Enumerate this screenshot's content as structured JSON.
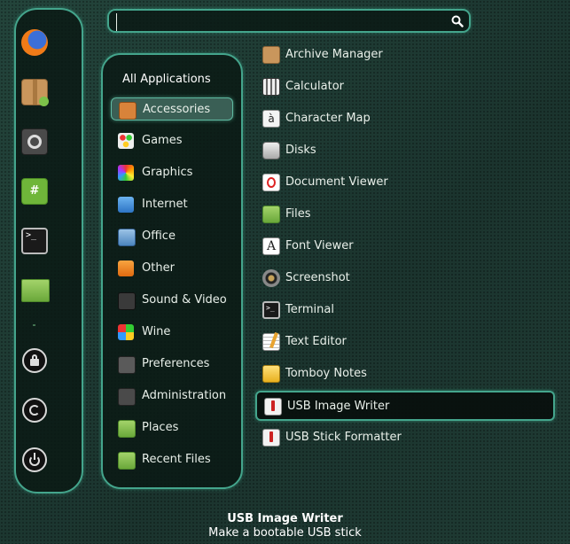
{
  "search": {
    "value": "",
    "placeholder": ""
  },
  "favorites": [
    {
      "name": "firefox-icon"
    },
    {
      "name": "package-installer-icon"
    },
    {
      "name": "system-settings-icon"
    },
    {
      "name": "hexchat-icon"
    },
    {
      "name": "terminal-icon"
    },
    {
      "name": "files-folder-icon"
    },
    {
      "name": "lock-screen-icon"
    },
    {
      "name": "logout-icon"
    },
    {
      "name": "shutdown-icon"
    }
  ],
  "categories": {
    "header": "All Applications",
    "items": [
      {
        "label": "Accessories",
        "selected": true
      },
      {
        "label": "Games"
      },
      {
        "label": "Graphics"
      },
      {
        "label": "Internet"
      },
      {
        "label": "Office"
      },
      {
        "label": "Other"
      },
      {
        "label": "Sound & Video"
      },
      {
        "label": "Wine"
      },
      {
        "label": "Preferences"
      },
      {
        "label": "Administration"
      },
      {
        "label": "Places"
      },
      {
        "label": "Recent Files"
      }
    ]
  },
  "apps": [
    {
      "label": "Archive Manager"
    },
    {
      "label": "Calculator"
    },
    {
      "label": "Character Map",
      "glyph": "à"
    },
    {
      "label": "Disks"
    },
    {
      "label": "Document Viewer"
    },
    {
      "label": "Files"
    },
    {
      "label": "Font Viewer",
      "glyph": "A"
    },
    {
      "label": "Screenshot"
    },
    {
      "label": "Terminal",
      "glyph": ">_"
    },
    {
      "label": "Text Editor"
    },
    {
      "label": "Tomboy Notes"
    },
    {
      "label": "USB Image Writer",
      "selected": true
    },
    {
      "label": "USB Stick Formatter"
    }
  ],
  "status": {
    "title": "USB Image Writer",
    "description": "Make a bootable USB stick"
  }
}
